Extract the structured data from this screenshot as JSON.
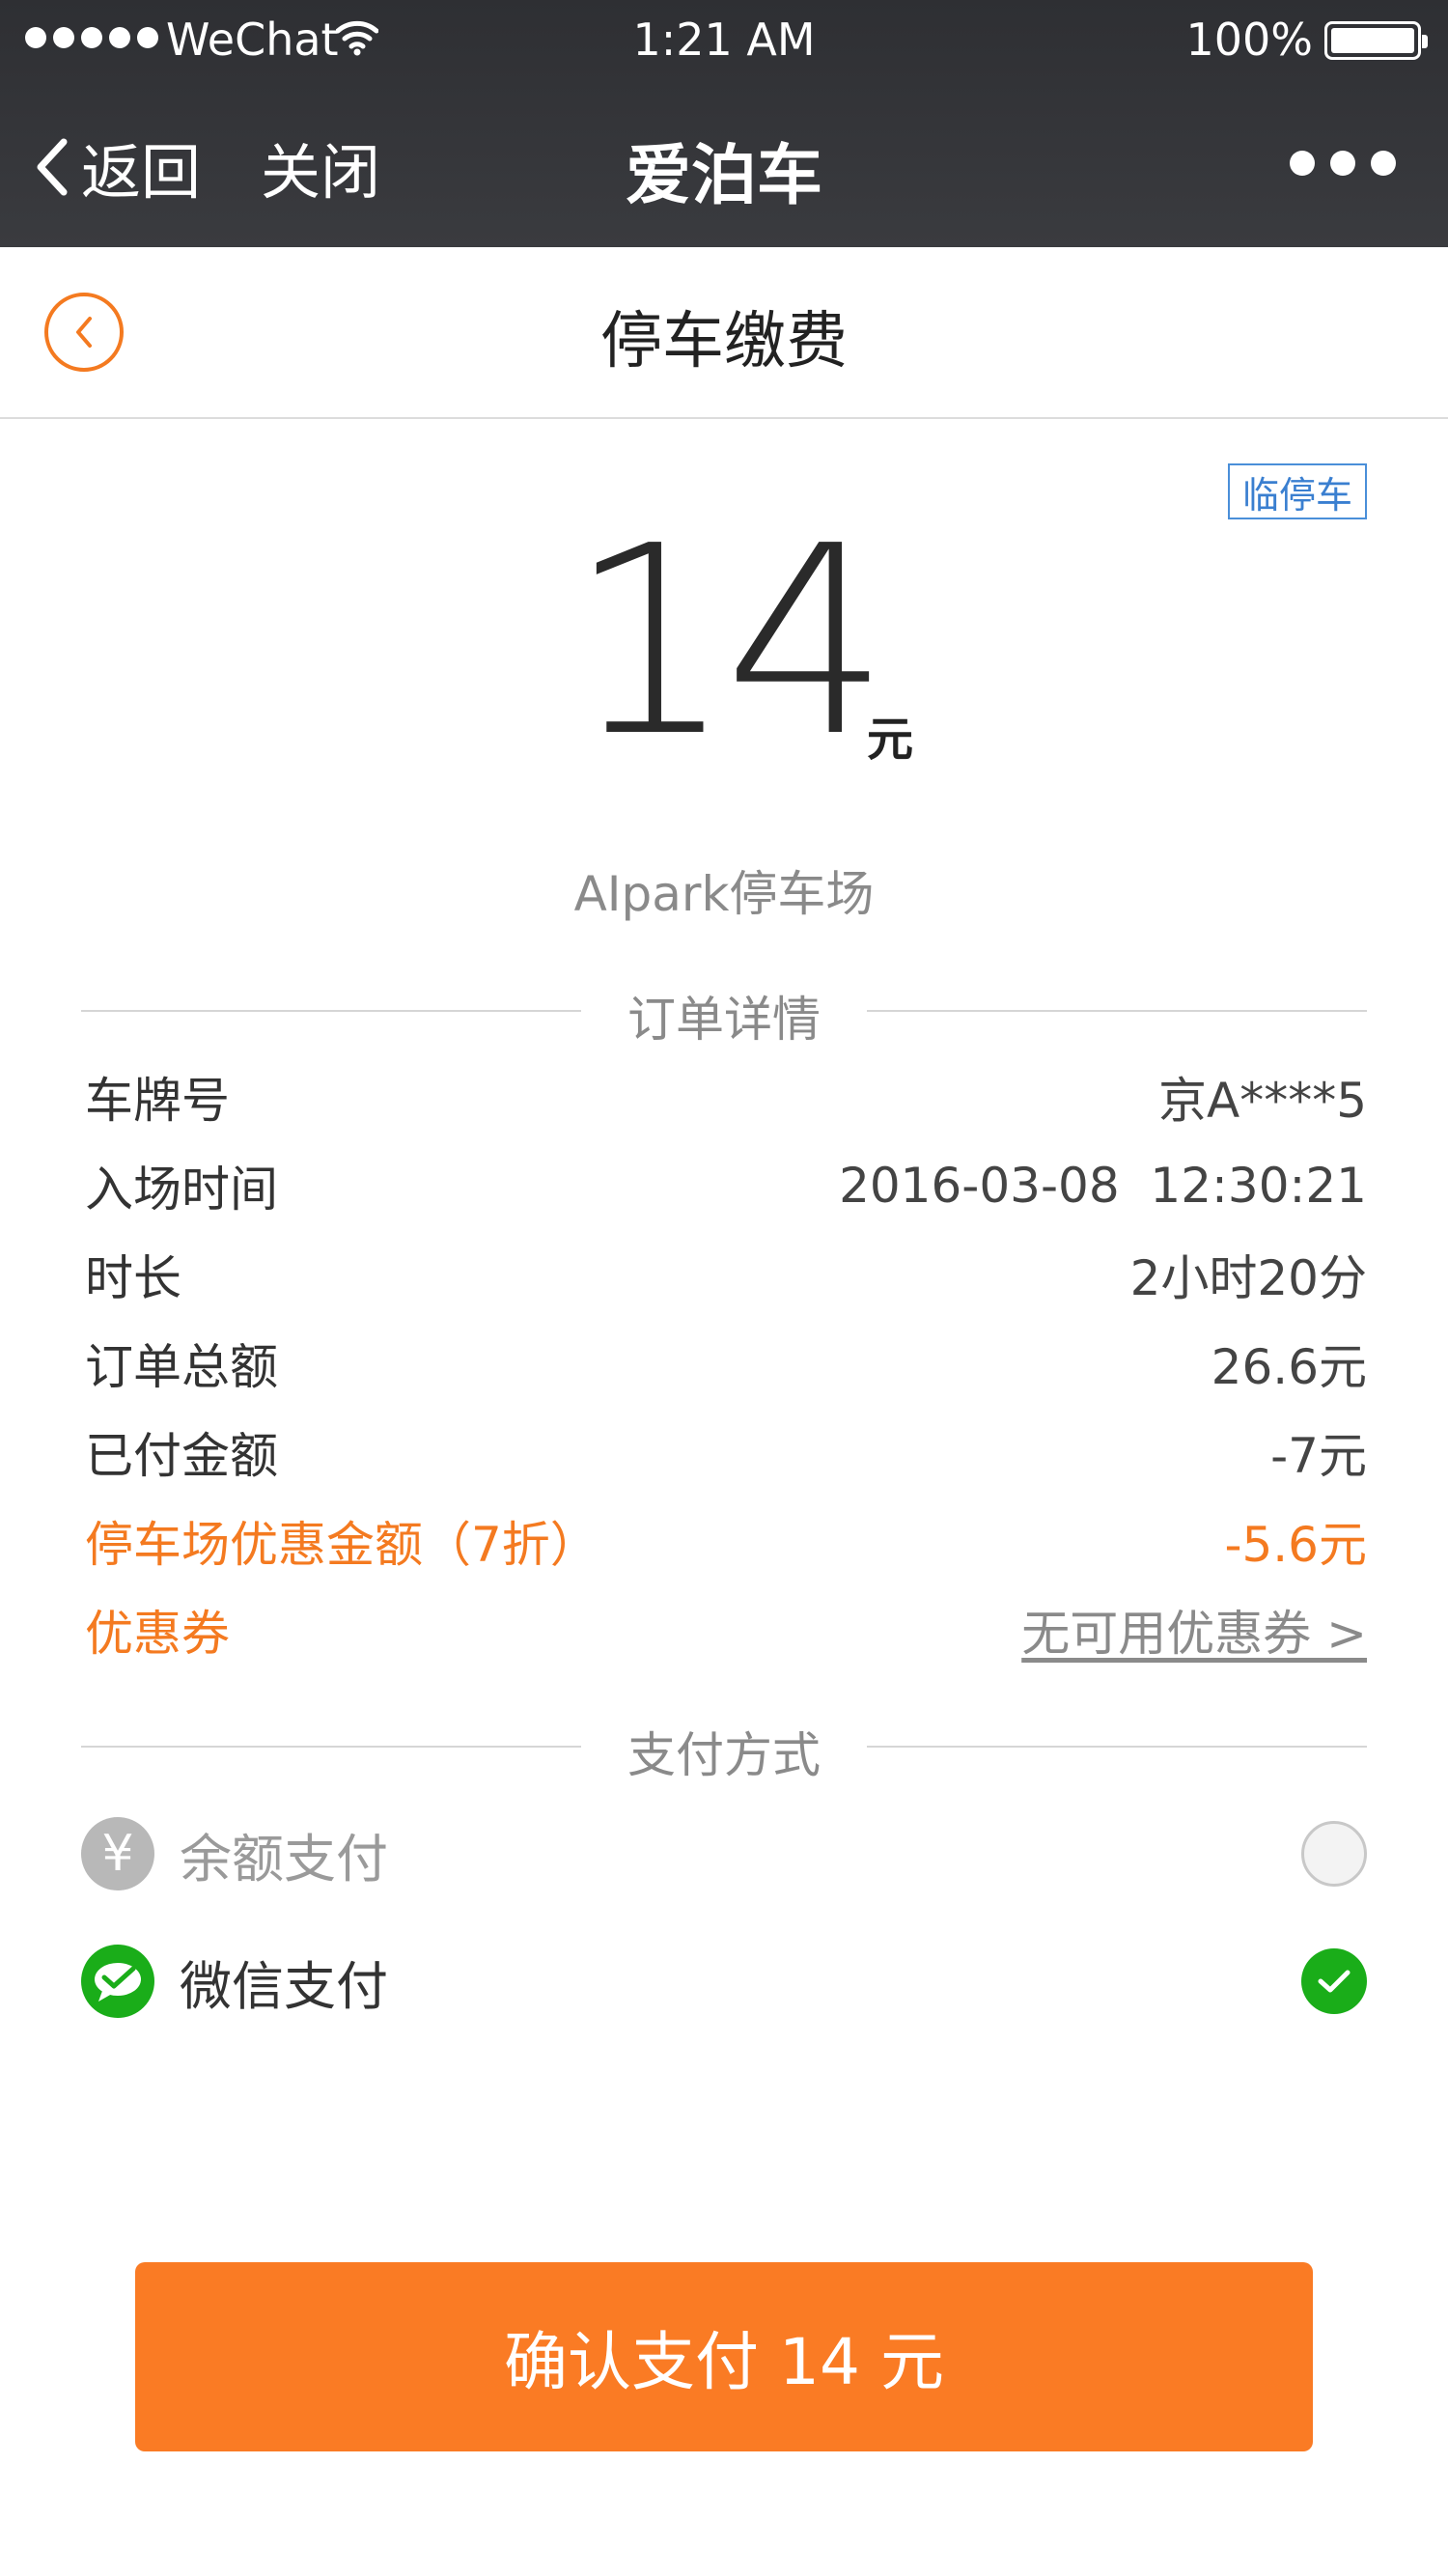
{
  "status_bar": {
    "carrier": "WeChat",
    "time": "1:21 AM",
    "battery": "100%"
  },
  "navbar": {
    "back_label": "返回",
    "close_label": "关闭",
    "title": "爱泊车"
  },
  "page": {
    "title": "停车缴费",
    "tag": "临停车",
    "amount": "14",
    "amount_unit": "元",
    "lot_name": "AIpark停车场"
  },
  "order_details": {
    "section_title": "订单详情",
    "rows": [
      {
        "label": "车牌号",
        "value": "京A****5"
      },
      {
        "label": "入场时间",
        "value": "2016-03-08  12:30:21"
      },
      {
        "label": "时长",
        "value": "2小时20分"
      },
      {
        "label": "订单总额",
        "value": "26.6元"
      },
      {
        "label": "已付金额",
        "value": "-7元"
      },
      {
        "label": "停车场优惠金额（7折）",
        "value": "-5.6元"
      },
      {
        "label": "优惠券",
        "value": "无可用优惠券 >"
      }
    ]
  },
  "payment": {
    "section_title": "支付方式",
    "methods": [
      {
        "label": "余额支付",
        "icon": "yen-icon",
        "selected": false
      },
      {
        "label": "微信支付",
        "icon": "wechat-pay-icon",
        "selected": true
      }
    ]
  },
  "confirm_button": {
    "label": "确认支付 14 元"
  },
  "colors": {
    "accent": "#fa7b24",
    "wechat_green": "#1aad19",
    "header_bg": "#35363a",
    "link_blue": "#3a7fd0"
  }
}
